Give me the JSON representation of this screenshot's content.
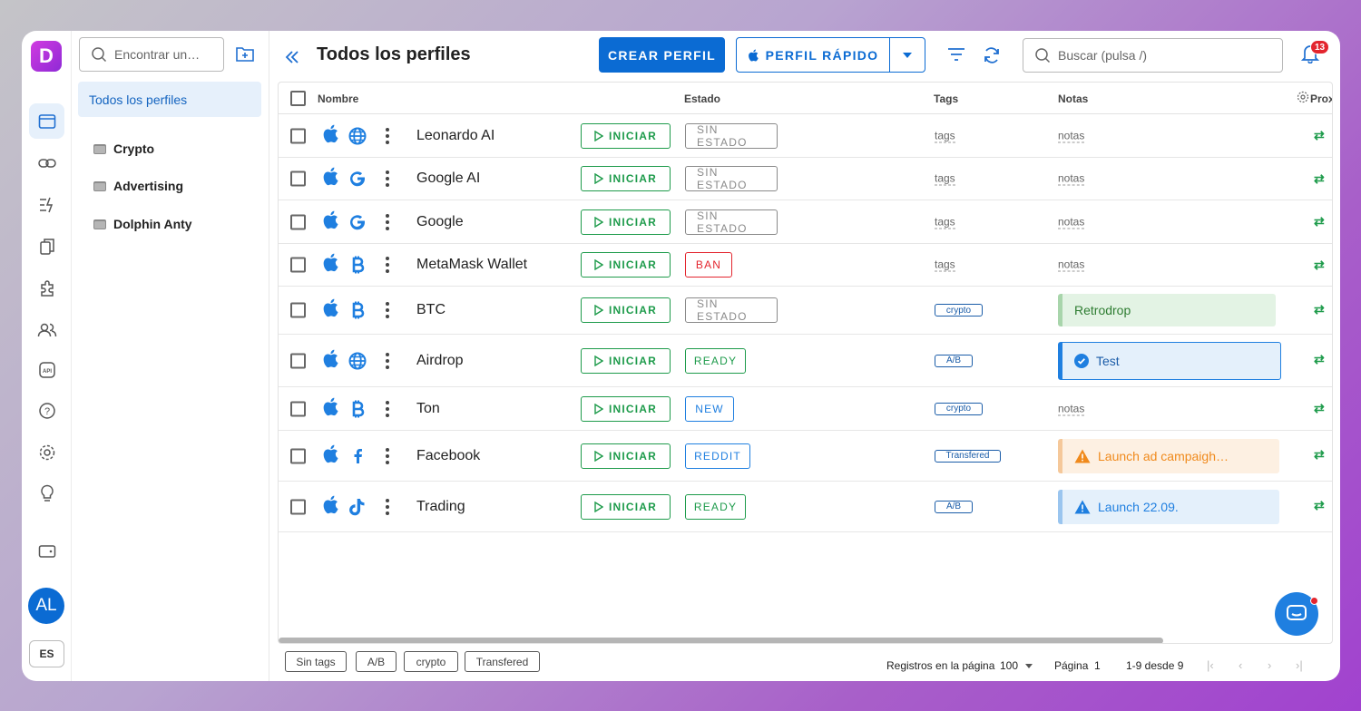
{
  "app": {
    "logo_letter": "D"
  },
  "rail": {
    "avatar": "AL",
    "lang": "ES"
  },
  "panel": {
    "find_placeholder": "Encontrar un…",
    "all_profiles": "Todos los perfiles",
    "folders": [
      "Crypto",
      "Advertising",
      "Dolphin Anty"
    ]
  },
  "header": {
    "title": "Todos los perfiles",
    "create": "CREAR PERFIL",
    "quick": "PERFIL RÁPIDO",
    "search_placeholder": "Buscar (pulsa /)",
    "notifications": "13"
  },
  "table": {
    "columns": {
      "name": "Nombre",
      "status": "Estado",
      "tags": "Tags",
      "notes": "Notas",
      "proxy": "Prox"
    },
    "start_label": "INICIAR",
    "rows": [
      {
        "name": "Leonardo AI",
        "icon": "globe-icon",
        "status": "SIN ESTADO",
        "status_color": "#8a8a8a",
        "tag": "tags",
        "tag_type": "empty",
        "note": "notas",
        "note_type": "empty"
      },
      {
        "name": "Google AI",
        "icon": "google-icon",
        "status": "SIN ESTADO",
        "status_color": "#8a8a8a",
        "tag": "tags",
        "tag_type": "empty",
        "note": "notas",
        "note_type": "empty"
      },
      {
        "name": "Google",
        "icon": "google-icon",
        "status": "SIN ESTADO",
        "status_color": "#8a8a8a",
        "tag": "tags",
        "tag_type": "empty",
        "note": "notas",
        "note_type": "empty"
      },
      {
        "name": "MetaMask Wallet",
        "icon": "bitcoin-icon",
        "status": "BAN",
        "status_color": "#e3252e",
        "tag": "tags",
        "tag_type": "empty",
        "note": "notas",
        "note_type": "empty"
      },
      {
        "name": "BTC",
        "icon": "bitcoin-icon",
        "status": "SIN ESTADO",
        "status_color": "#8a8a8a",
        "tag": "crypto",
        "tag_type": "chip",
        "note": "Retrodrop",
        "note_type": "green"
      },
      {
        "name": "Airdrop",
        "icon": "globe-icon",
        "status": "READY",
        "status_color": "#1e9b4b",
        "tag": "A/B",
        "tag_type": "chip",
        "note": "Test",
        "note_type": "info-check"
      },
      {
        "name": "Ton",
        "icon": "bitcoin-icon",
        "status": "NEW",
        "status_color": "#1f7fe0",
        "tag": "crypto",
        "tag_type": "chip",
        "note": "notas",
        "note_type": "empty"
      },
      {
        "name": "Facebook",
        "icon": "facebook-icon",
        "status": "REDDIT",
        "status_color": "#1f7fe0",
        "tag": "Transfered",
        "tag_type": "chip",
        "note": "Launch ad campaigh…",
        "note_type": "warning"
      },
      {
        "name": "Trading",
        "icon": "tiktok-icon",
        "status": "READY",
        "status_color": "#1e9b4b",
        "tag": "A/B",
        "tag_type": "chip",
        "note": "Launch 22.09.",
        "note_type": "info-warn"
      }
    ]
  },
  "footer": {
    "tag_filters": [
      "Sin tags",
      "A/B",
      "crypto",
      "Transfered"
    ],
    "per_page_label": "Registros en la página",
    "per_page": "100",
    "page_label": "Página",
    "page": "1",
    "range": "1-9 desde 9"
  }
}
